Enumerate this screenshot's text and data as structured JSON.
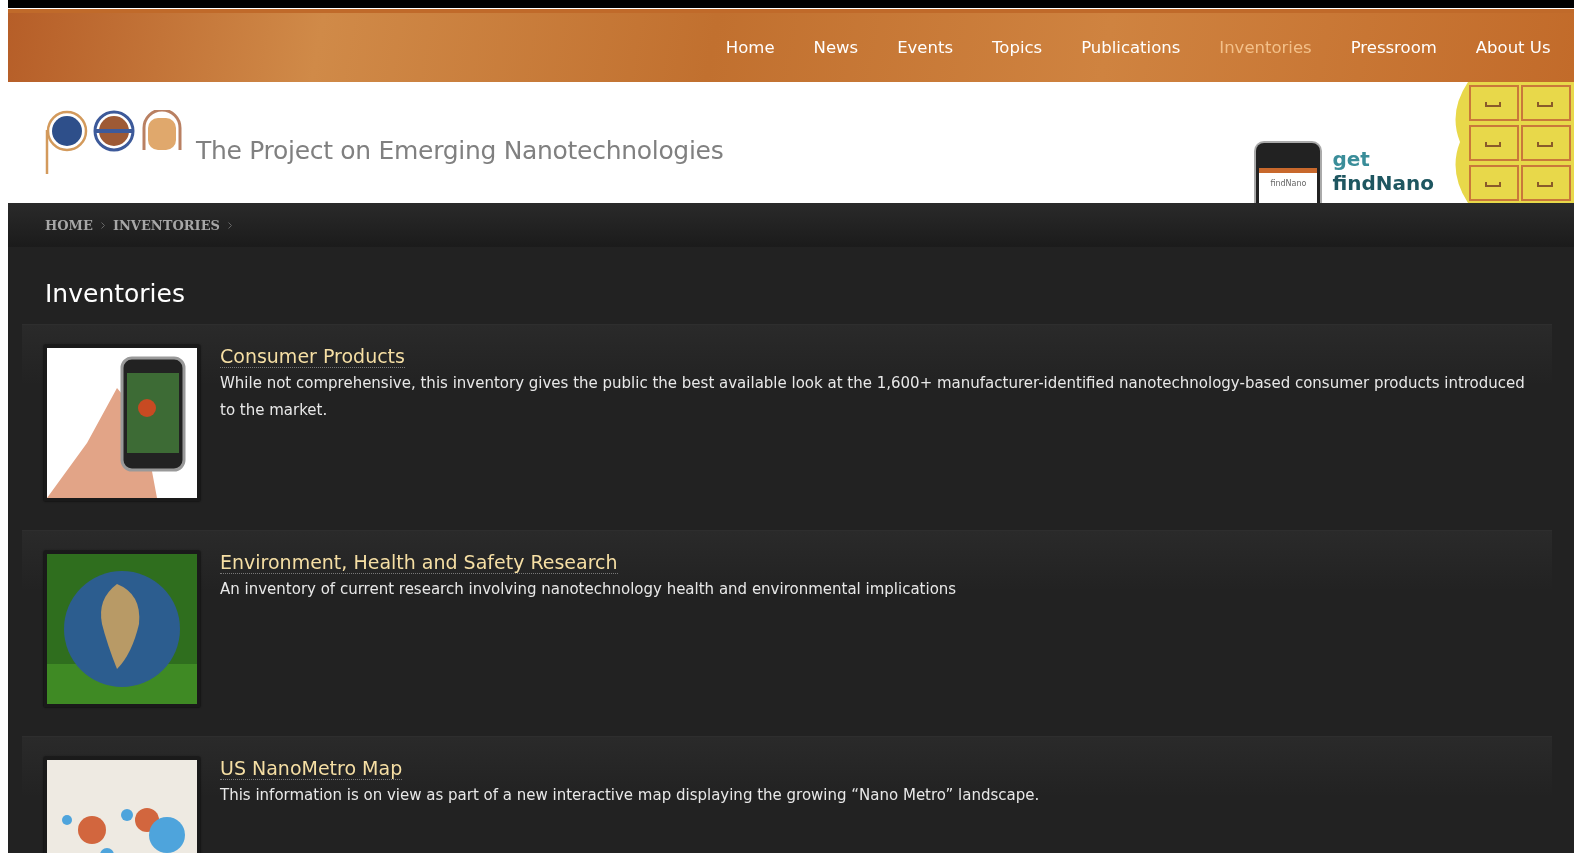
{
  "nav": [
    {
      "label": "Home",
      "selected": false
    },
    {
      "label": "News",
      "selected": false
    },
    {
      "label": "Events",
      "selected": false
    },
    {
      "label": "Topics",
      "selected": false
    },
    {
      "label": "Publications",
      "selected": false
    },
    {
      "label": "Inventories",
      "selected": true
    },
    {
      "label": "Pressroom",
      "selected": false
    },
    {
      "label": "About Us",
      "selected": false
    }
  ],
  "header": {
    "site_title": "The Project on Emerging Nanotechnologies",
    "promo": {
      "line_1": "get",
      "line_2": "findNano",
      "phone_screen": "findNano"
    }
  },
  "breadcrumb": [
    "HOME",
    "INVENTORIES"
  ],
  "page_title": "Inventories",
  "items": [
    {
      "title": "Consumer Products",
      "description": "While not comprehensive, this inventory gives the public the best available look at the 1,600+ manufacturer-identified nanotechnology-based consumer products introduced to the market.",
      "kind": "phone"
    },
    {
      "title": "Environment, Health and Safety Research",
      "description": "An inventory of current research involving nanotechnology health and environmental implications",
      "kind": "globe"
    },
    {
      "title": "US NanoMetro Map",
      "description": "This information is on view as part of a new interactive map displaying the growing “Nano Metro” landscape.",
      "kind": "map"
    }
  ]
}
